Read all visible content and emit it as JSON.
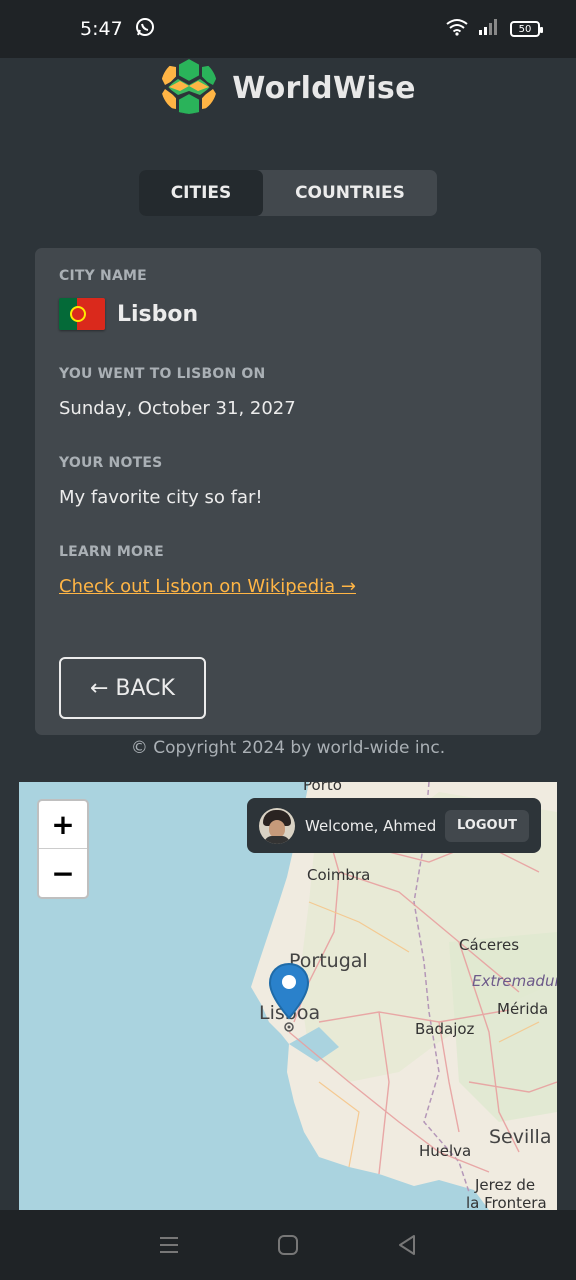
{
  "status_bar": {
    "time": "5:47",
    "battery": "50"
  },
  "app": {
    "name": "WorldWise"
  },
  "tabs": [
    {
      "label": "CITIES",
      "active": true
    },
    {
      "label": "COUNTRIES",
      "active": false
    }
  ],
  "city": {
    "name_label": "CITY NAME",
    "name": "Lisbon",
    "date_label": "YOU WENT TO LISBON ON",
    "date": "Sunday, October 31, 2027",
    "notes_label": "YOUR NOTES",
    "notes": "My favorite city so far!",
    "learn_label": "LEARN MORE",
    "wiki_link": "Check out Lisbon on Wikipedia →",
    "back_label": "← BACK"
  },
  "footer": {
    "copyright": "© Copyright 2024 by world-wide inc."
  },
  "map": {
    "zoom_in": "+",
    "zoom_out": "−",
    "welcome": "Welcome, Ahmed",
    "logout": "LOGOUT",
    "places": {
      "porto": "Porto",
      "coimbra": "Coimbra",
      "portugal": "Portugal",
      "caceres": "Cáceres",
      "extremadura": "Extremadur",
      "lisboa": "Lisboa",
      "badajoz": "Badajoz",
      "merida": "Mérida",
      "sevilla": "Sevilla",
      "huelva": "Huelva",
      "jerez": "Jerez de",
      "frontera": "la Frontera"
    }
  },
  "colors": {
    "accent": "#ffb545",
    "background": "#2d3439",
    "card": "#42484d",
    "water": "#aad3df"
  }
}
